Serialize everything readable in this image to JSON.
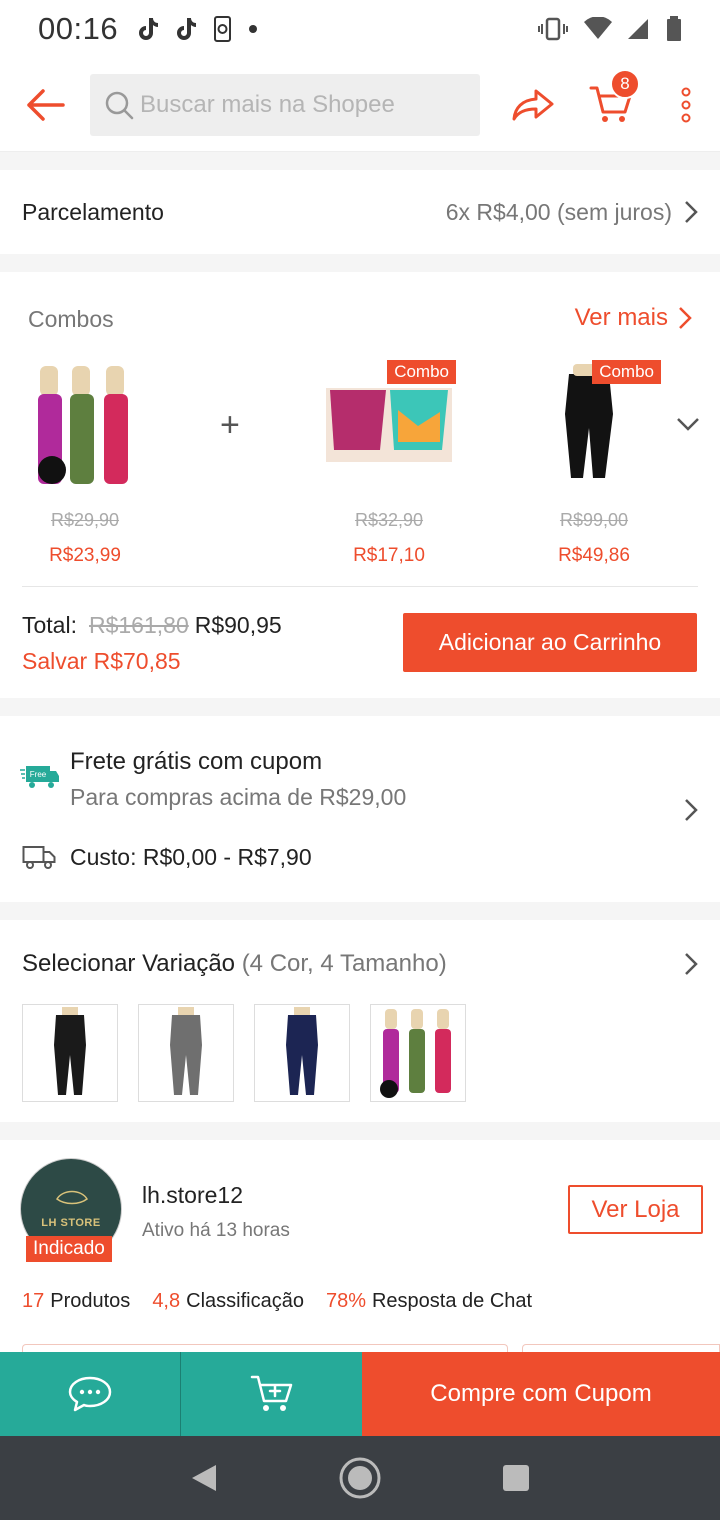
{
  "status_bar": {
    "time": "00:16"
  },
  "header": {
    "search_placeholder": "Buscar mais na Shopee",
    "cart_count": "8"
  },
  "installment": {
    "label": "Parcelamento",
    "value": "6x R$4,00 (sem juros)"
  },
  "combos": {
    "title": "Combos",
    "see_more": "Ver mais",
    "items": [
      {
        "old_price": "R$29,90",
        "new_price": "R$23,99",
        "tag": ""
      },
      {
        "old_price": "R$32,90",
        "new_price": "R$17,10",
        "tag": "Combo"
      },
      {
        "old_price": "R$99,00",
        "new_price": "R$49,86",
        "tag": "Combo"
      }
    ],
    "plus": "+",
    "total_label": "Total:",
    "total_old": "R$161,80",
    "total_new": "R$90,95",
    "save_label": "Salvar",
    "save_value": "R$70,85",
    "add_button": "Adicionar ao Carrinho"
  },
  "shipping": {
    "free_badge": "Free",
    "title": "Frete grátis com cupom",
    "subtitle": "Para compras acima de R$29,00",
    "cost": "Custo: R$0,00 - R$7,90"
  },
  "variation": {
    "title": "Selecionar Variação",
    "subtitle": "(4 Cor, 4 Tamanho)"
  },
  "shop": {
    "avatar_text": "LH STORE",
    "badge": "Indicado",
    "name": "lh.store12",
    "active": "Ativo há 13 horas",
    "visit_button": "Ver Loja",
    "stats": [
      {
        "num": "17",
        "label": "Produtos"
      },
      {
        "num": "4,8",
        "label": "Classificação"
      },
      {
        "num": "78%",
        "label": "Resposta de Chat"
      }
    ]
  },
  "bottom_bar": {
    "buy_label": "Compre com Cupom"
  },
  "colors": {
    "brand": "#ee4d2d",
    "teal": "#26aa99"
  }
}
